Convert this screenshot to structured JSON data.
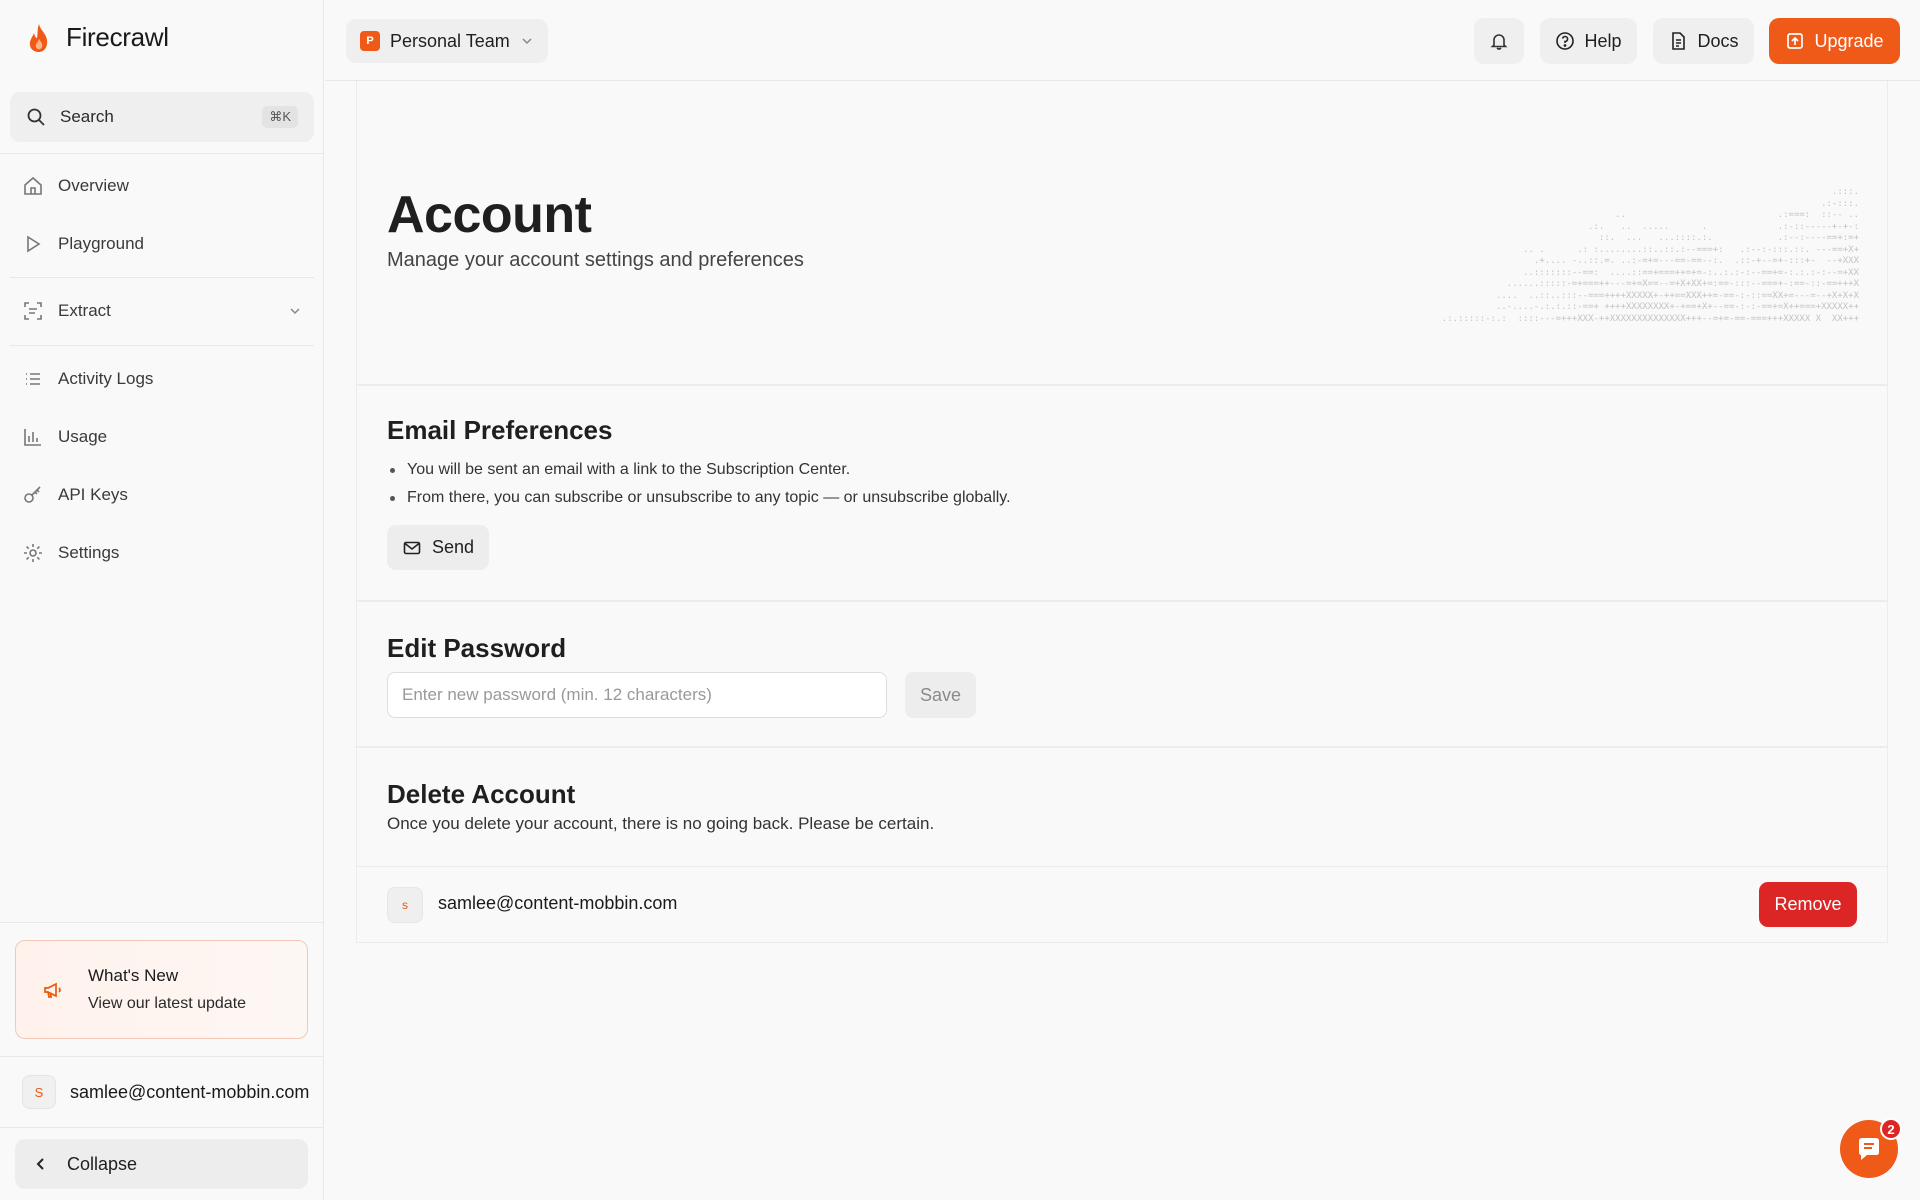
{
  "app": {
    "name": "Firecrawl",
    "accent": "#f05a19",
    "danger": "#dc2626"
  },
  "sidebar": {
    "search": {
      "label": "Search",
      "shortcut": "⌘K"
    },
    "items": [
      {
        "label": "Overview",
        "icon": "home-icon"
      },
      {
        "label": "Playground",
        "icon": "play-icon"
      },
      {
        "label": "Extract",
        "icon": "extract-icon"
      },
      {
        "label": "Activity Logs",
        "icon": "list-icon"
      },
      {
        "label": "Usage",
        "icon": "bar-chart-icon"
      },
      {
        "label": "API Keys",
        "icon": "key-icon"
      },
      {
        "label": "Settings",
        "icon": "gear-icon"
      }
    ],
    "whats_new": {
      "title": "What's New",
      "subtitle": "View our latest update"
    },
    "user": {
      "initial": "S",
      "email": "samlee@content-mobbin.com"
    },
    "collapse_label": "Collapse"
  },
  "topbar": {
    "team": {
      "badge": "P",
      "name": "Personal Team"
    },
    "help_label": "Help",
    "docs_label": "Docs",
    "upgrade_label": "Upgrade"
  },
  "page": {
    "title": "Account",
    "subtitle": "Manage your account settings and preferences"
  },
  "email_prefs": {
    "title": "Email Preferences",
    "bullets": [
      "You will be sent an email with a link to the Subscription Center.",
      "From there, you can subscribe or unsubscribe to any topic — or unsubscribe globally."
    ],
    "send_label": "Send"
  },
  "password": {
    "title": "Edit Password",
    "placeholder": "Enter new password (min. 12 characters)",
    "value": "",
    "save_label": "Save"
  },
  "delete_account": {
    "title": "Delete Account",
    "description": "Once you delete your account, there is no going back. Please be certain.",
    "member": {
      "initial": "s",
      "email": "samlee@content-mobbin.com"
    },
    "remove_label": "Remove"
  },
  "chat": {
    "unread_count": "2"
  }
}
